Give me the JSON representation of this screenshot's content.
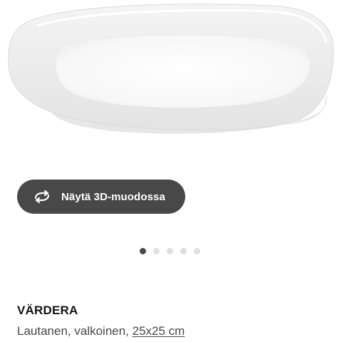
{
  "product_image": {
    "icon": "plate-image"
  },
  "view_3d": {
    "label": "Näytä 3D-muodossa",
    "icon": "rotate-3d-icon"
  },
  "carousel": {
    "total": 5,
    "active_index": 0
  },
  "product": {
    "name": "VÄRDERA",
    "description_prefix": "Lautanen, valkoinen,",
    "size": "25x25 cm"
  },
  "colors": {
    "button_bg": "#484848",
    "dot_active": "#484848",
    "dot_inactive": "#dfdfdf",
    "text_primary": "#111111",
    "text_secondary": "#484848"
  }
}
